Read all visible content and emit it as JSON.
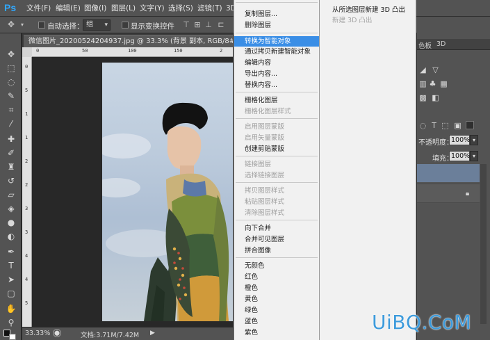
{
  "app": {
    "logo": "Ps"
  },
  "menubar": {
    "items": [
      {
        "label": "文件(F)"
      },
      {
        "label": "编辑(E)"
      },
      {
        "label": "图像(I)"
      },
      {
        "label": "图层(L)"
      },
      {
        "label": "文字(Y)"
      },
      {
        "label": "选择(S)"
      },
      {
        "label": "滤镜(T)"
      },
      {
        "label": "3D"
      }
    ]
  },
  "options_bar": {
    "auto_select_label": "自动选择：",
    "auto_select_value": "组",
    "transform_controls_label": "显示变换控件"
  },
  "document": {
    "tab_title": "微信图片_20200524204937.jpg @ 33.3% (背景 副本, RGB/8#) *"
  },
  "ruler": {
    "top_ticks": [
      "0",
      "50",
      "100",
      "150",
      "2"
    ],
    "left_ticks": [
      "0",
      "5",
      "1",
      "1",
      "2",
      "2",
      "3",
      "3",
      "4",
      "4",
      "5"
    ]
  },
  "status_bar": {
    "zoom": "33.33%",
    "doc_size": "文档:3.71M/7.42M"
  },
  "context_menu": {
    "items": [
      {
        "label": "复制图层...",
        "enabled": true
      },
      {
        "label": "删除图层",
        "enabled": true
      },
      {
        "label": "转换为智能对象",
        "enabled": true,
        "highlighted": true
      },
      {
        "label": "通过拷贝新建智能对象",
        "enabled": true
      },
      {
        "label": "编辑内容",
        "enabled": true
      },
      {
        "label": "导出内容...",
        "enabled": true
      },
      {
        "label": "替换内容...",
        "enabled": true
      },
      {
        "label": "栅格化图层",
        "enabled": true
      },
      {
        "label": "栅格化图层样式",
        "enabled": false
      },
      {
        "label": "启用图层蒙版",
        "enabled": false
      },
      {
        "label": "启用矢量蒙版",
        "enabled": false
      },
      {
        "label": "创建剪贴蒙版",
        "enabled": true
      },
      {
        "label": "链接图层",
        "enabled": false
      },
      {
        "label": "选择链接图层",
        "enabled": false
      },
      {
        "label": "拷贝图层样式",
        "enabled": false
      },
      {
        "label": "粘贴图层样式",
        "enabled": false
      },
      {
        "label": "清除图层样式",
        "enabled": false
      },
      {
        "label": "向下合并",
        "enabled": true
      },
      {
        "label": "合并可见图层",
        "enabled": true
      },
      {
        "label": "拼合图像",
        "enabled": true
      },
      {
        "label": "无颜色",
        "enabled": true
      },
      {
        "label": "红色",
        "enabled": true
      },
      {
        "label": "橙色",
        "enabled": true
      },
      {
        "label": "黄色",
        "enabled": true
      },
      {
        "label": "绿色",
        "enabled": true
      },
      {
        "label": "蓝色",
        "enabled": true
      },
      {
        "label": "紫色",
        "enabled": true
      }
    ]
  },
  "submenu_3d": {
    "items": [
      {
        "label": "从所选图层新建 3D 凸出",
        "enabled": true
      },
      {
        "label": "新建 3D 凸出",
        "enabled": false
      }
    ]
  },
  "right_panel": {
    "tab_label": "色板",
    "tab_label_2": "3D",
    "opacity_label": "不透明度：",
    "opacity_value": "100%",
    "fill_label": "填充：",
    "fill_value": "100%"
  },
  "watermark": {
    "text": "UiBQ.CoM"
  },
  "colors": {
    "highlight": "#3a8ee6",
    "ps_blue": "#31a8ff",
    "watermark": "#3d9bdc"
  }
}
